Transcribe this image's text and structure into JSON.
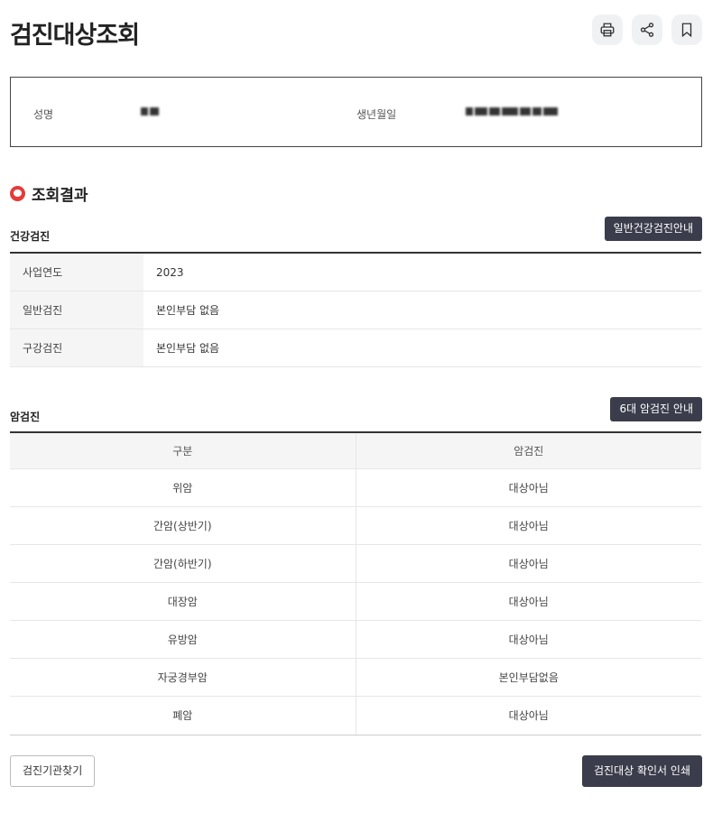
{
  "header": {
    "title": "검진대상조회",
    "icons": [
      "printer-icon",
      "share-icon",
      "bookmark-icon"
    ]
  },
  "person": {
    "name_label": "성명",
    "birth_label": "생년월일"
  },
  "result": {
    "title": "조회결과"
  },
  "health_checkup": {
    "section_title": "건강검진",
    "guide_button": "일반건강검진안내",
    "rows": [
      {
        "label": "사업연도",
        "value": "2023"
      },
      {
        "label": "일반검진",
        "value": "본인부담 없음"
      },
      {
        "label": "구강검진",
        "value": "본인부담 없음"
      }
    ]
  },
  "cancer_checkup": {
    "section_title": "암검진",
    "guide_button": "6대 암검진 안내",
    "headers": [
      "구분",
      "암검진"
    ],
    "rows": [
      {
        "type": "위암",
        "status": "대상아님"
      },
      {
        "type": "간암(상반기)",
        "status": "대상아님"
      },
      {
        "type": "간암(하반기)",
        "status": "대상아님"
      },
      {
        "type": "대장암",
        "status": "대상아님"
      },
      {
        "type": "유방암",
        "status": "대상아님"
      },
      {
        "type": "자궁경부암",
        "status": "본인부담없음"
      },
      {
        "type": "폐암",
        "status": "대상아님"
      }
    ]
  },
  "footer": {
    "find_institution_button": "검진기관찾기",
    "print_button": "검진대상 확인서 인쇄"
  },
  "colors": {
    "dark_button": "#3b3d4c",
    "accent_red": "#e53b3b"
  }
}
